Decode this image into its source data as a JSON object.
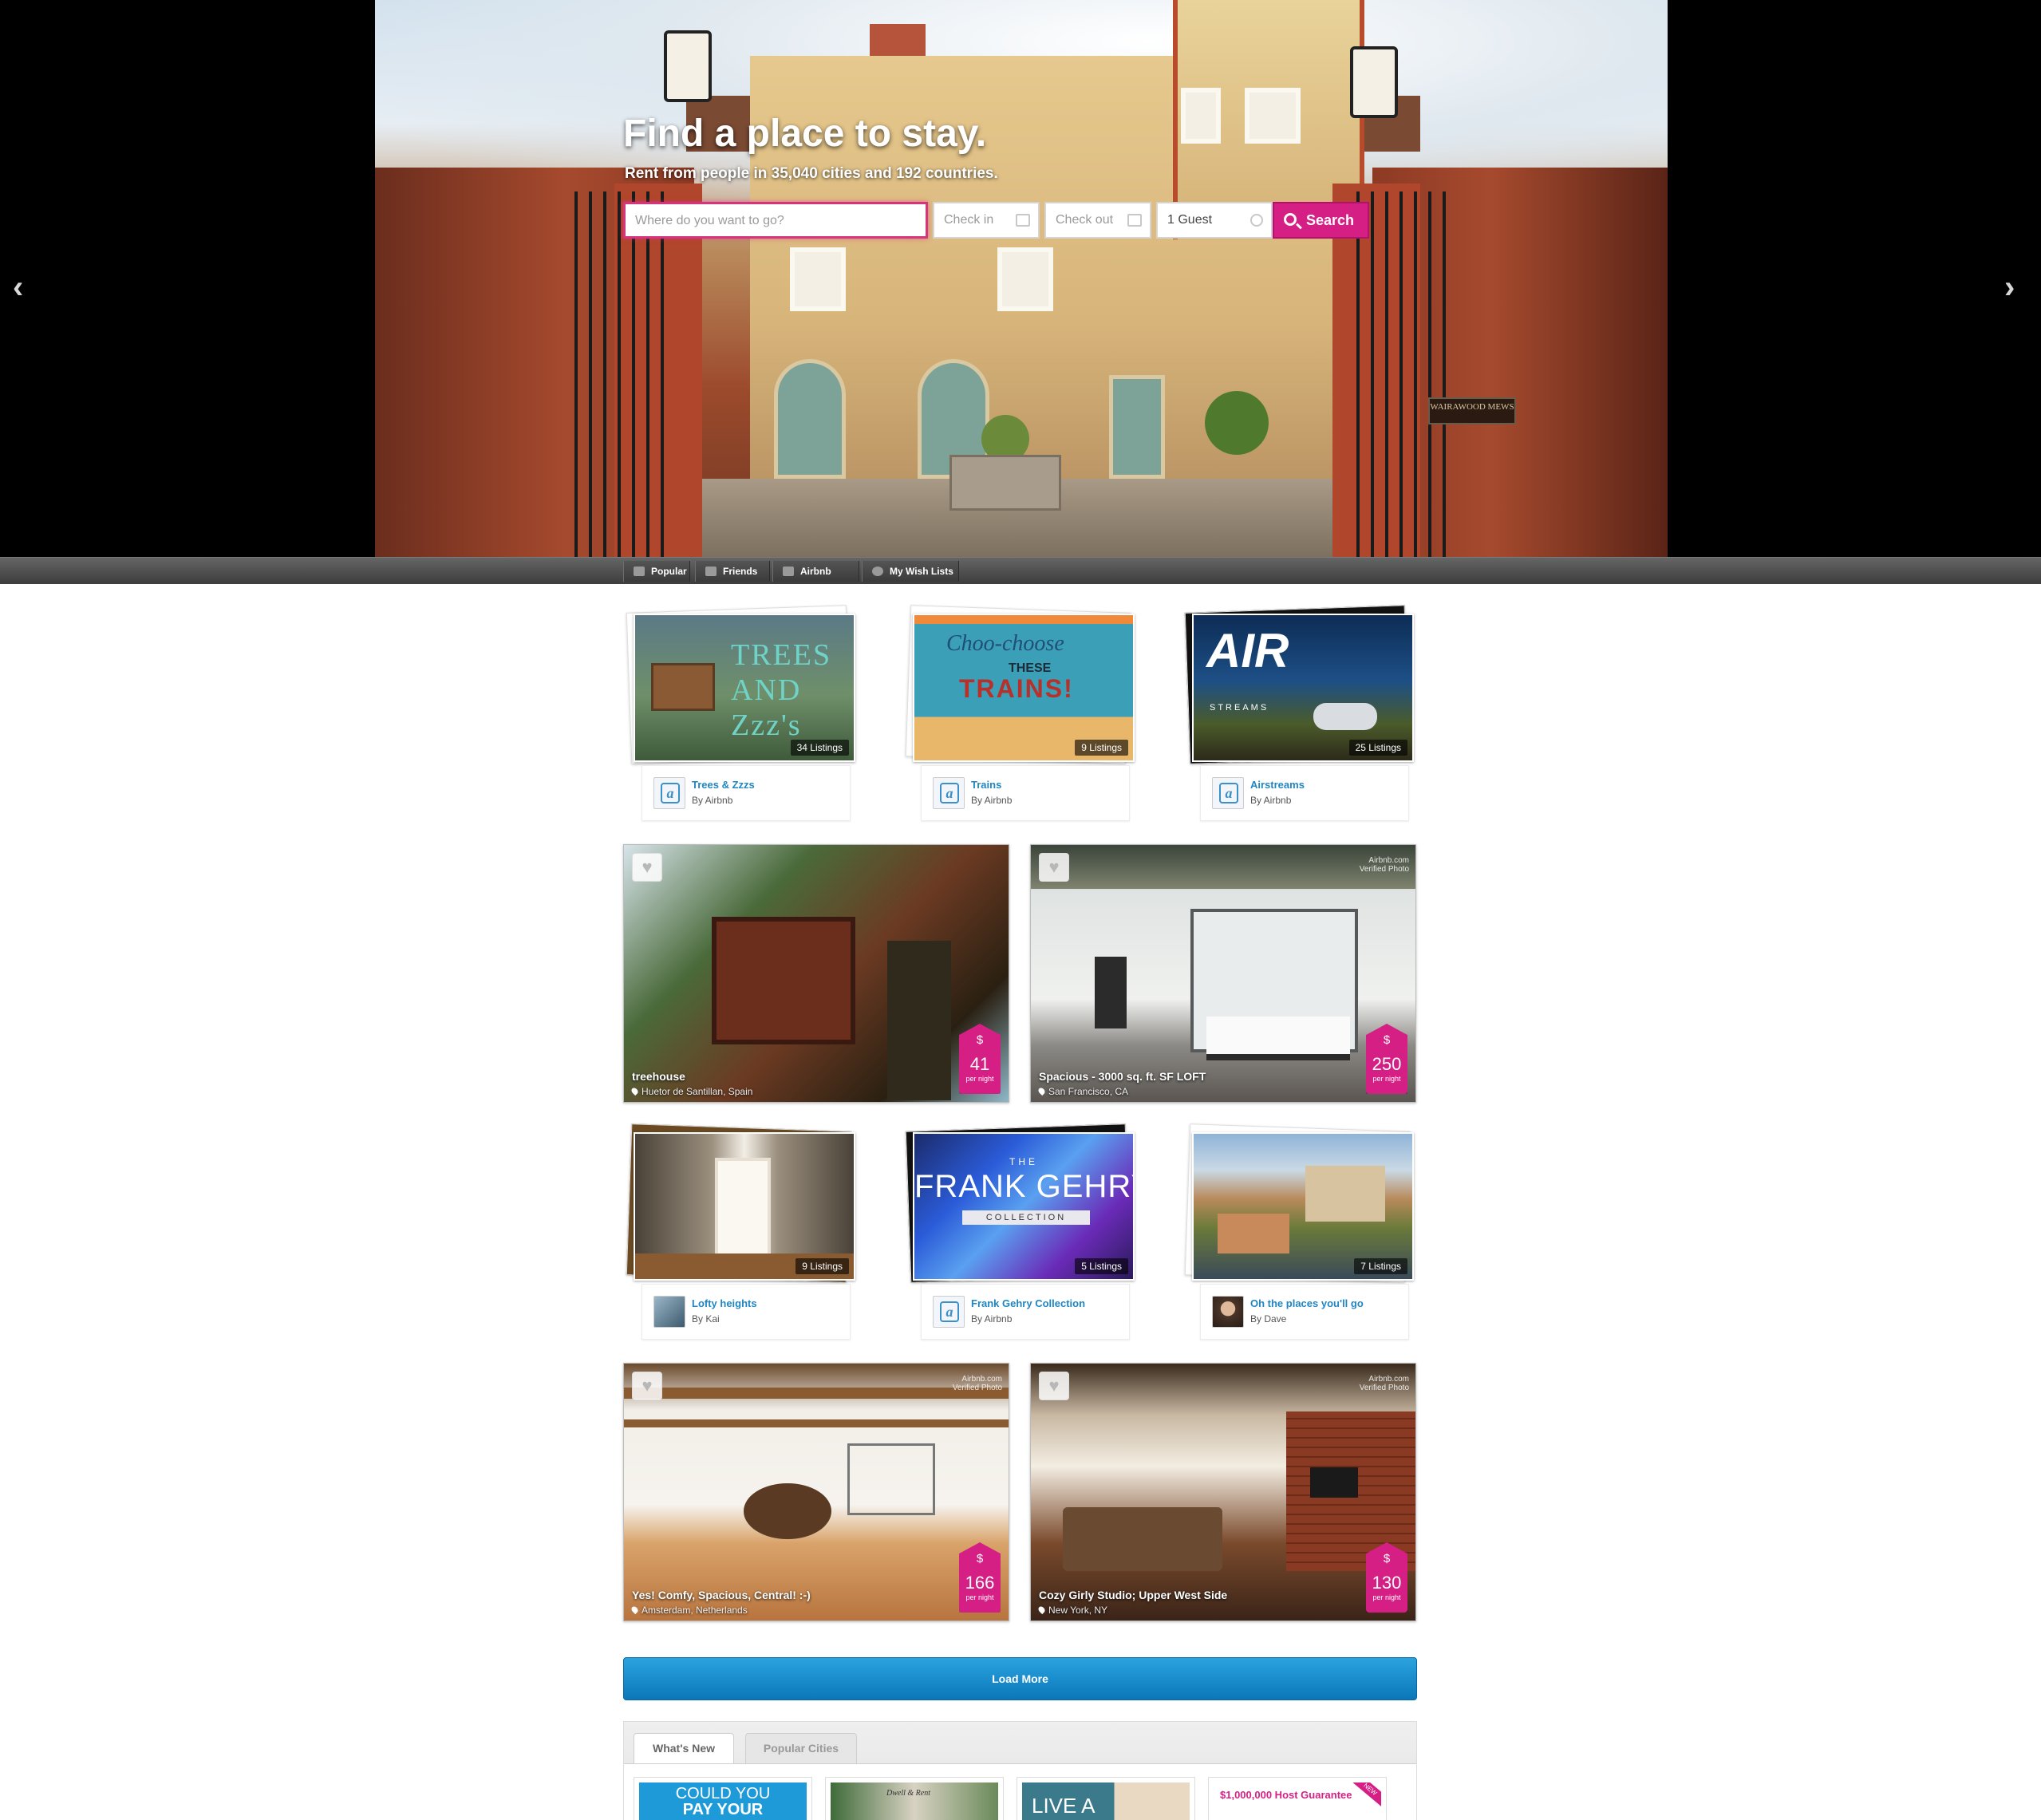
{
  "hero": {
    "title": "Find a place to stay.",
    "subtitle": "Rent from people in 35,040 cities and 192 countries.",
    "search": {
      "where_placeholder": "Where do you want to go?",
      "checkin_placeholder": "Check in",
      "checkout_placeholder": "Check out",
      "guests_value": "1 Guest",
      "search_label": "Search"
    },
    "prev_arrow": "‹",
    "next_arrow": "›",
    "plaque_text": "WAIRAWOOD MEWS"
  },
  "nav_tabs": [
    {
      "label": "Popular",
      "icon": "flame-icon"
    },
    {
      "label": "Friends",
      "icon": "people-icon"
    },
    {
      "label": "Airbnb Picks",
      "icon": "airbnb-icon"
    },
    {
      "label": "My Wish Lists",
      "icon": "heart-icon"
    }
  ],
  "collections": [
    {
      "title": "Trees & Zzzs",
      "by": "By Airbnb",
      "count": "34 Listings",
      "art_text": "TREES AND Zzz's"
    },
    {
      "title": "Trains",
      "by": "By Airbnb",
      "count": "9 Listings",
      "art_text_1": "Choo-choose",
      "art_text_2": "THESE",
      "art_text_3": "TRAINS!"
    },
    {
      "title": "Airstreams",
      "by": "By Airbnb",
      "count": "25 Listings",
      "art_text_1": "AIR",
      "art_text_2": "STREAMS"
    },
    {
      "title": "Lofty heights",
      "by": "By Kai",
      "count": "9 Listings"
    },
    {
      "title": "Frank Gehry Collection",
      "by": "By Airbnb",
      "count": "5 Listings",
      "art_text_1": "THE",
      "art_text_2": "FRANK GEHRY",
      "art_text_3": "COLLECTION"
    },
    {
      "title": "Oh the places you'll go",
      "by": "By Dave",
      "count": "7 Listings"
    }
  ],
  "listings": [
    {
      "title": "treehouse",
      "location": "Huetor de Santillan, Spain",
      "price": "41",
      "verified": false
    },
    {
      "title": "Spacious - 3000 sq. ft. SF LOFT",
      "location": "San Francisco, CA",
      "price": "250",
      "verified": true
    },
    {
      "title": "Yes! Comfy, Spacious, Central! :-)",
      "location": "Amsterdam, Netherlands",
      "price": "166",
      "verified": true
    },
    {
      "title": "Cozy Girly Studio; Upper West Side",
      "location": "New York, NY",
      "price": "130",
      "verified": true
    }
  ],
  "price_symbol": "$",
  "price_per": "per night",
  "verified_text_1": "Airbnb.com",
  "verified_text_2": "Verified Photo",
  "load_more": "Load More",
  "bottom_tabs": {
    "active": "What's New",
    "inactive": "Popular Cities"
  },
  "promos": [
    {
      "text_1": "COULD YOU",
      "text_2": "PAY YOUR"
    },
    {
      "text": "Dwell & Rent"
    },
    {
      "text": "LIVE A"
    },
    {
      "text": "$1,000,000 Host Guarantee",
      "badge": "NEW"
    }
  ],
  "colors": {
    "brand_pink": "#d61f85",
    "link_blue": "#1f86c3",
    "button_blue": "#1b8ccc"
  }
}
